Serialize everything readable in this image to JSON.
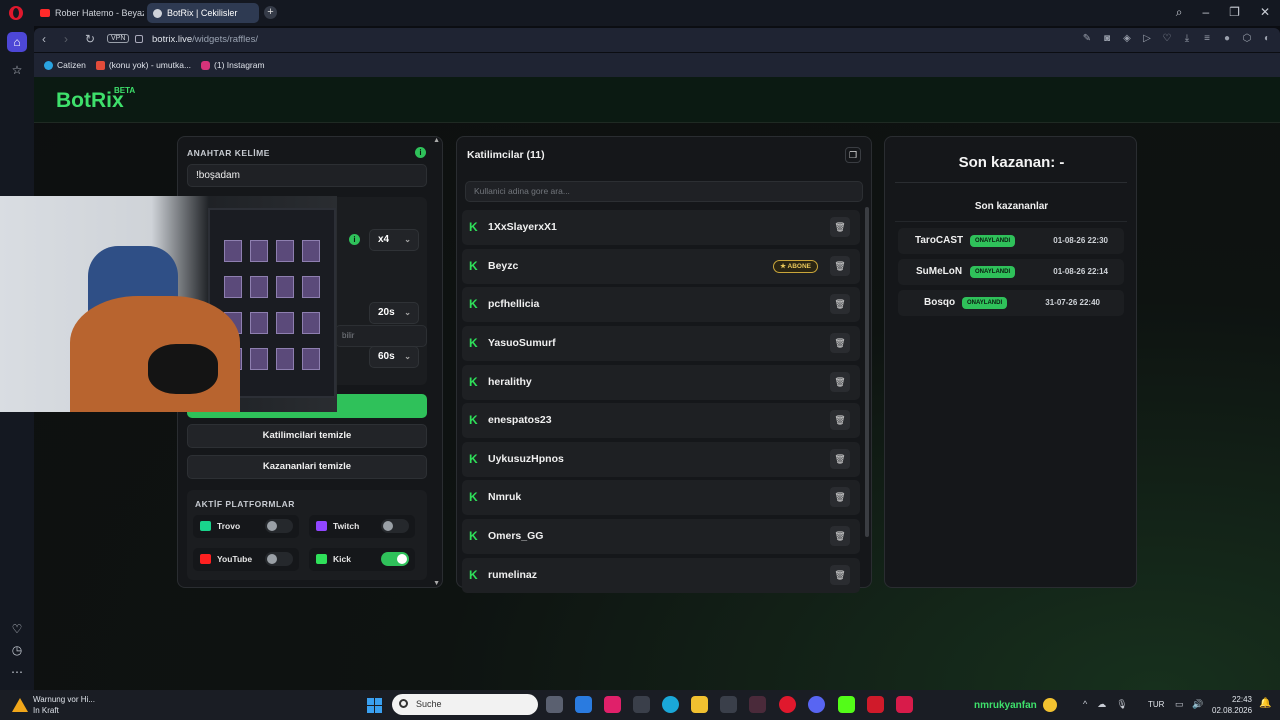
{
  "browser": {
    "tabs": [
      {
        "label": "Rober Hatemo - Beyaz"
      },
      {
        "label": "BotRix | Cekilisler"
      }
    ],
    "new_tab": "+",
    "vpn": "VPN",
    "url_host": "botrix.live",
    "url_path": "/widgets/raffles/",
    "bookmarks": [
      {
        "label": "Catizen",
        "color": "#2aa3e0"
      },
      {
        "label": "(konu yok) - umutka...",
        "color": "#e24b3a"
      },
      {
        "label": "(1) Instagram",
        "color": "#d6337a"
      }
    ],
    "window_controls": [
      "search-icon",
      "minimize-icon",
      "restore-icon",
      "close-icon"
    ]
  },
  "brand": {
    "name": "BotRix",
    "badge": "BETA",
    "accent": "#3ee06b"
  },
  "settings": {
    "keyword_label": "ANAHTAR KELİME",
    "keyword_value": "!boşadam",
    "multiplier_value": "x4",
    "ghost_placeholder": "bilir",
    "timer_1": "20s",
    "timer_2": "60s",
    "clear_participants": "Katilimcilari temizle",
    "clear_winners": "Kazananlari temizle",
    "platforms_title": "AKTİF PLATFORMLAR",
    "platforms": [
      {
        "name": "Trovo",
        "enabled": false,
        "color": "#19d48c"
      },
      {
        "name": "Twitch",
        "enabled": false,
        "color": "#9146ff"
      },
      {
        "name": "YouTube",
        "enabled": false,
        "color": "#ff2020"
      },
      {
        "name": "Kick",
        "enabled": true,
        "color": "#2fe05a"
      }
    ]
  },
  "participants": {
    "title": "Katilimcilar (11)",
    "search_placeholder": "Kullanici adina gore ara...",
    "subscriber_label": "ABONE",
    "list": [
      {
        "name": "1XxSlayerxX1",
        "subscriber": false
      },
      {
        "name": "Beyzc",
        "subscriber": true
      },
      {
        "name": "pcfhellicia",
        "subscriber": false
      },
      {
        "name": "YasuoSumurf",
        "subscriber": false
      },
      {
        "name": "heralithy",
        "subscriber": false
      },
      {
        "name": "enespatos23",
        "subscriber": false
      },
      {
        "name": "UykusuzHpnos",
        "subscriber": false
      },
      {
        "name": "Nmruk",
        "subscriber": false
      },
      {
        "name": "Omers_GG",
        "subscriber": false
      },
      {
        "name": "rumelinaz",
        "subscriber": false
      }
    ]
  },
  "winners": {
    "last_winner": "Son kazanan: -",
    "recent_title": "Son kazananlar",
    "approved_label": "ONAYLANDI",
    "list": [
      {
        "name": "TaroCAST",
        "date": "01-08-26 22:30"
      },
      {
        "name": "SuMeLoN",
        "date": "01-08-26 22:14"
      },
      {
        "name": "Bosqo",
        "date": "31-07-26 22:40"
      }
    ]
  },
  "taskbar": {
    "warning_title": "Warnung vor Hi...",
    "warning_sub": "In Kraft",
    "search_placeholder": "Suche",
    "user": "nmrukyanfan",
    "lang": "TUR",
    "time": "22:43",
    "date": "02.08.2026"
  }
}
